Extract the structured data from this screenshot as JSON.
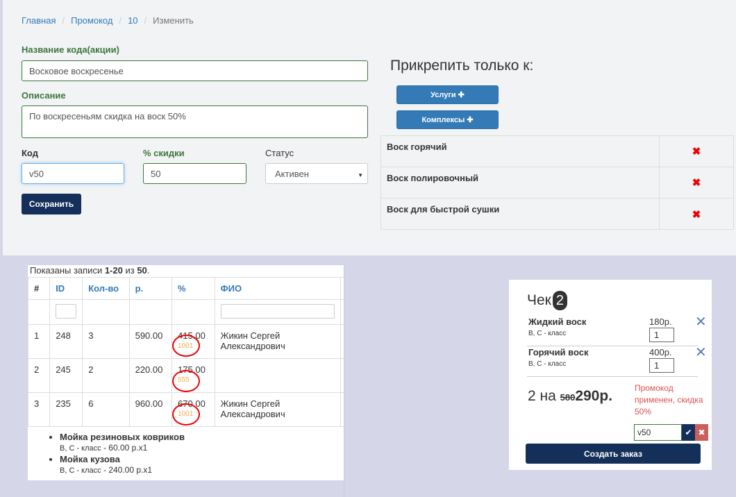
{
  "breadcrumb": [
    "Главная",
    "Промокод",
    "10",
    "Изменить"
  ],
  "form": {
    "name_label": "Название кода(акции)",
    "name_value": "Восковое воскресенье",
    "desc_label": "Описание",
    "desc_value": "По воскресеньям скидка на воск 50%",
    "code_label": "Код",
    "code_value": "v50",
    "discount_label": "% скидки",
    "discount_value": "50",
    "status_label": "Статус",
    "status_value": "Активен",
    "save_label": "Сохранить"
  },
  "attach": {
    "title": "Прикрепить только к:",
    "services_label": "Услуги",
    "complexes_label": "Комплексы",
    "items": [
      "Воск горячий",
      "Воск полировочный",
      "Воск для быстрой сушки"
    ]
  },
  "records": {
    "info_prefix": "Показаны записи ",
    "info_range": "1-20",
    "info_mid": " из ",
    "info_total": "50",
    "info_suffix": ".",
    "headers": [
      "#",
      "ID",
      "Кол-во",
      "р.",
      "%",
      "ФИО"
    ],
    "rows": [
      {
        "n": "1",
        "id": "248",
        "qty": "3",
        "price": "590.00",
        "pct": "415.00",
        "code": "1001",
        "fio": "Жикин Сергей Александрович"
      },
      {
        "n": "2",
        "id": "245",
        "qty": "2",
        "price": "220.00",
        "pct": "175.00",
        "code": "555",
        "fio": ""
      },
      {
        "n": "3",
        "id": "235",
        "qty": "6",
        "price": "960.00",
        "pct": "670.00",
        "code": "1001",
        "fio": "Жикин Сергей Александрович"
      }
    ],
    "details": [
      {
        "name": "Мойка резиновых ковриков",
        "class": "В, С - класс",
        "value": " - 60.00 р.x1"
      },
      {
        "name": "Мойка кузова",
        "class": "В, С - класс",
        "value": " - 240.00 р.x1"
      }
    ]
  },
  "check": {
    "title": "Чек",
    "count": "2",
    "items": [
      {
        "name": "Жидкий воск",
        "class": "В, С - класс",
        "price": "180р.",
        "qty": "1"
      },
      {
        "name": "Горячий воск",
        "class": "В, С - класс",
        "price": "400р.",
        "qty": "1"
      }
    ],
    "total_prefix": "2 на ",
    "old_total": "580",
    "new_total": "290р.",
    "promo_message": "Промокод применен, скидка 50%",
    "promo_value": "v50",
    "create_label": "Создать заказ"
  }
}
